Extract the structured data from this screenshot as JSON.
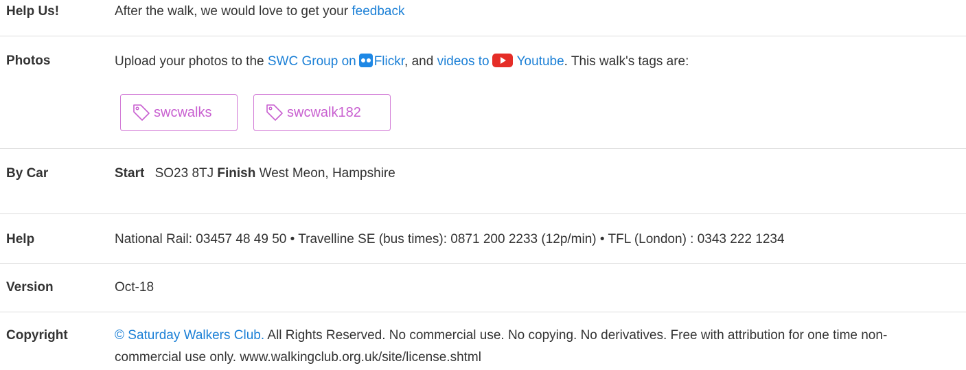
{
  "help_us": {
    "label": "Help Us!",
    "text": "After the walk, we would love to get your",
    "link": "feedback"
  },
  "photos": {
    "label": "Photos",
    "text_before": "Upload your photos to the",
    "flickr_link_a": "SWC Group on",
    "flickr_icon": "flickr-icon",
    "flickr_link_b": "Flickr",
    "mid_text": ", and",
    "youtube_link_a": "videos to",
    "youtube_icon": "youtube-icon",
    "youtube_link_b": "Youtube",
    "text_after": ". This walk's tags are:",
    "tags": [
      "swcwalks",
      "swcwalk182"
    ],
    "tag_icon": "tag-icon",
    "tag_color": "#c85fd0"
  },
  "by_car": {
    "label": "By Car",
    "start_label": "Start",
    "start_value": "SO23 8TJ",
    "finish_label": "Finish",
    "finish_value": "West Meon, Hampshire"
  },
  "help": {
    "label": "Help",
    "text": "National Rail: 03457 48 49 50 • Travelline SE (bus times): 0871 200 2233 (12p/min) • TFL (London) : 0343 222 1234"
  },
  "version": {
    "label": "Version",
    "value": "Oct-18"
  },
  "copyright": {
    "label": "Copyright",
    "link": "© Saturday Walkers Club.",
    "text": "All Rights Reserved. No commercial use. No copying. No derivatives. Free with attribution for one time non-commercial use only. www.walkingclub.org.uk/site/license.shtml"
  },
  "colors": {
    "link": "#1a7fd6",
    "tag": "#c85fd0",
    "divider": "#dcdcdc",
    "text": "#333333"
  }
}
